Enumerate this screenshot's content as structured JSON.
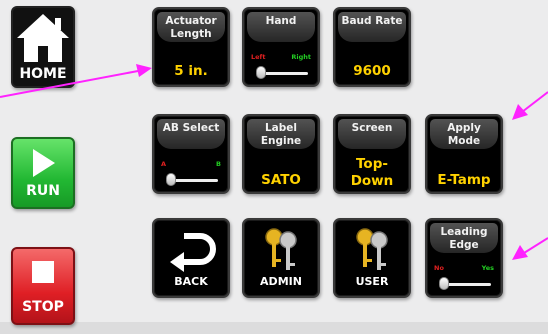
{
  "sidebar": {
    "home_label": "HOME",
    "run_label": "RUN",
    "stop_label": "STOP"
  },
  "grid": {
    "actuator_length": {
      "title_line1": "Actuator",
      "title_line2": "Length",
      "value": "5 in."
    },
    "hand": {
      "title": "Hand",
      "left_label": "Left",
      "right_label": "Right"
    },
    "baud_rate": {
      "title": "Baud Rate",
      "value": "9600"
    },
    "ab_select": {
      "title": "AB Select",
      "left_label": "A",
      "right_label": "B"
    },
    "label_engine": {
      "title_line1": "Label",
      "title_line2": "Engine",
      "value": "SATO"
    },
    "screen": {
      "title": "Screen",
      "value_line1": "Top-",
      "value_line2": "Down"
    },
    "apply_mode": {
      "title_line1": "Apply",
      "title_line2": "Mode",
      "value": "E-Tamp"
    },
    "back": {
      "label": "BACK"
    },
    "admin": {
      "label": "ADMIN"
    },
    "user": {
      "label": "USER"
    },
    "leading_edge": {
      "title_line1": "Leading",
      "title_line2": "Edge",
      "left_label": "No",
      "right_label": "Yes"
    }
  },
  "colors": {
    "value_yellow": "#ffd200",
    "arrow_magenta": "#ff22ff",
    "run_green": "#22b833",
    "stop_red": "#df1f25"
  },
  "icons": [
    "home-icon",
    "play-icon",
    "stop-square-icon",
    "back-arrow-icon",
    "keys-icon"
  ]
}
